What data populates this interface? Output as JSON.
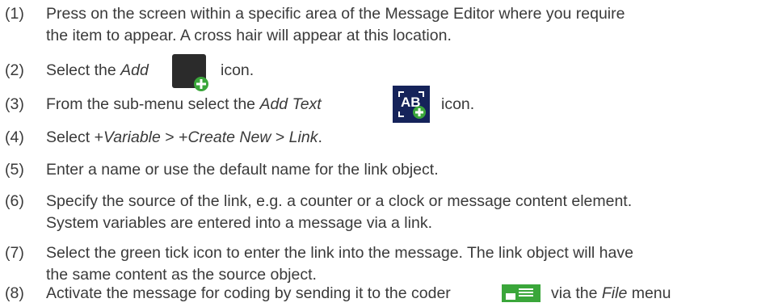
{
  "steps": [
    {
      "num": "(1)",
      "line1": "Press on the screen within a specific area of the Message Editor where you require",
      "line2": "the item to appear. A cross hair will appear at this location."
    },
    {
      "num": "(2)",
      "pre": "Select the ",
      "italic": "Add",
      "post": "icon.",
      "icon": "add-icon"
    },
    {
      "num": "(3)",
      "pre": "From the sub-menu select the ",
      "italic": "Add Text",
      "post": "icon.",
      "icon": "add-text-icon",
      "icon_text": "AB"
    },
    {
      "num": "(4)",
      "pre": "Select +",
      "i1": "Variable",
      "mid1": " > +",
      "i2": "Create New",
      "mid2": " > ",
      "i3": "Link",
      "post": "."
    },
    {
      "num": "(5)",
      "line1": "Enter a name or use the default name for the link object."
    },
    {
      "num": "(6)",
      "line1": "Specify the source of the link, e.g. a counter or a clock or message content element.",
      "line2": "System variables are entered into a message via a link."
    },
    {
      "num": "(7)",
      "line1": "Select the green tick icon to enter the link into the message. The link object will have",
      "line2": "the same content as the source object."
    },
    {
      "num": "(8)",
      "pre": "Activate the message for coding by sending it to the coder",
      "post": "via the ",
      "italic": "File",
      "post2": " menu",
      "icon": "send-to-coder-icon"
    }
  ],
  "colors": {
    "text": "#3a3a3a",
    "icon_dark": "#2b2b2b",
    "icon_navy": "#15235a",
    "icon_green": "#3aa63a"
  }
}
